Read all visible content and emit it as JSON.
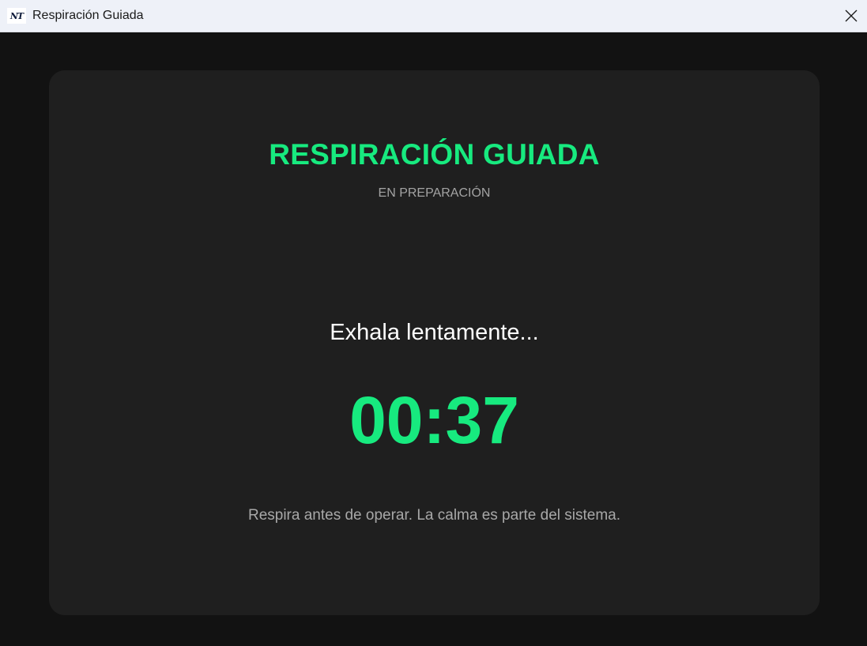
{
  "window": {
    "title": "Respiración Guiada",
    "icon_name": "app-logo-icon",
    "icon_text": "NT"
  },
  "card": {
    "title": "RESPIRACIÓN GUIADA",
    "status": "EN PREPARACIÓN",
    "instruction": "Exhala lentamente...",
    "timer": "00:37",
    "footer": "Respira antes de operar. La calma es parte del sistema."
  },
  "colors": {
    "accent": "#17ea7f",
    "background": "#121212",
    "card": "#1f1f1f",
    "titlebar": "#eef1f8"
  }
}
